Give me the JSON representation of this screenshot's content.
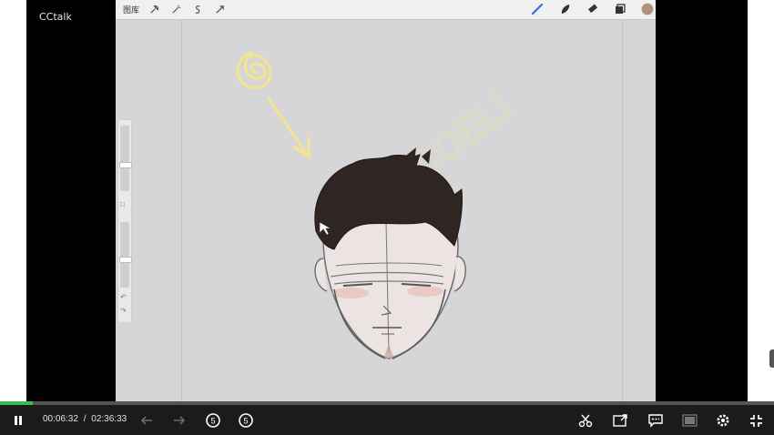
{
  "app": {
    "brand": "CCtalk"
  },
  "canvas_toolbar": {
    "gallery_label": "图库",
    "tools": [
      "wrench-icon",
      "magic-wand-icon",
      "selection-icon",
      "transform-icon"
    ],
    "right_tools": [
      "brush-icon",
      "smudge-icon",
      "eraser-icon",
      "layers-icon"
    ],
    "color_swatch": "#b68e7a"
  },
  "drawing": {
    "watermark": "COELI",
    "sketch_color": "#f3e58e"
  },
  "player": {
    "current_time": "00:06:32",
    "separator": "/",
    "total_time": "02:36:33",
    "progress_fraction": 0.0418,
    "progress_color": "#32c14a",
    "rewind_label": "5",
    "forward_label": "5",
    "controls": [
      "pause-icon",
      "prev-icon",
      "next-icon",
      "rewind-5-icon",
      "forward-5-icon",
      "clip-icon",
      "share-icon",
      "danmaku-icon",
      "screen-icon",
      "settings-icon",
      "exit-fullscreen-icon"
    ]
  }
}
